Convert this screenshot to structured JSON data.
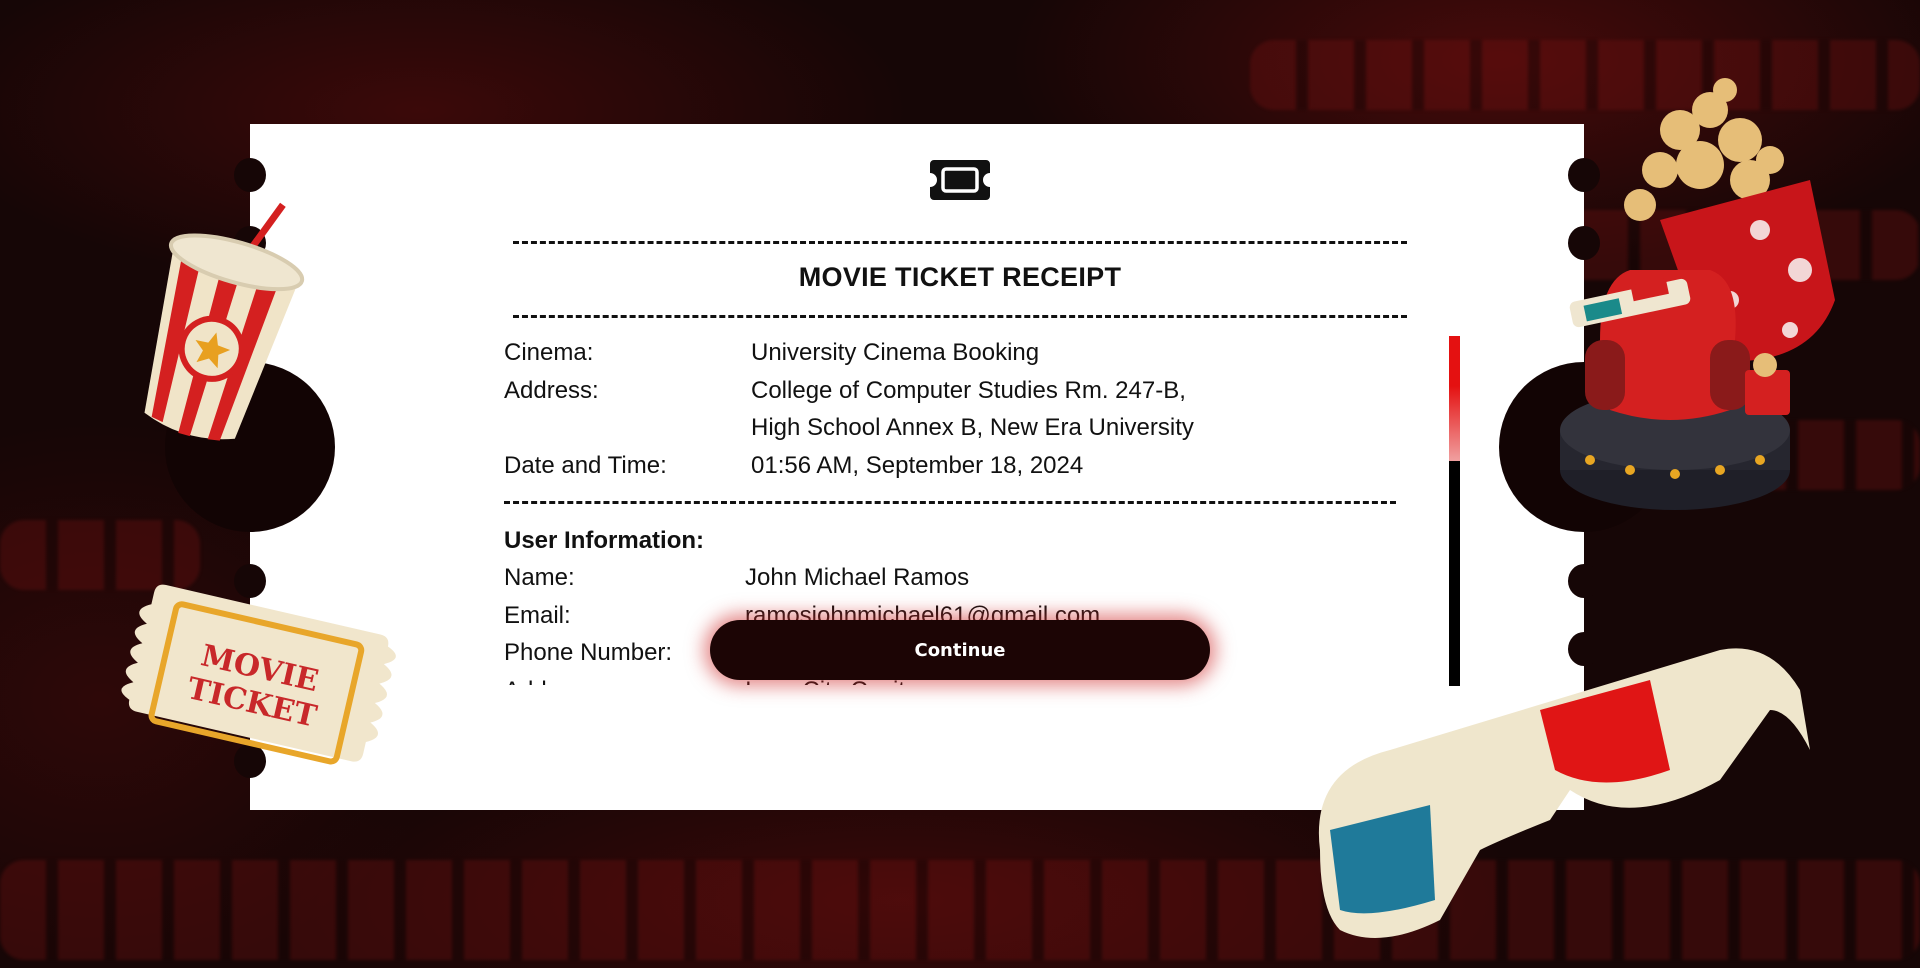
{
  "background_theme": "dark red cinema seats",
  "colors": {
    "accent": "#e41111",
    "button_bg": "#1c0505",
    "card_bg": "#ffffff"
  },
  "receipt": {
    "title": "MOVIE TICKET RECEIPT",
    "header_icon": "ticket-icon",
    "cinema_label": "Cinema:",
    "cinema_value": "University Cinema Booking",
    "address_label": "Address:",
    "address_line1": "College of Computer Studies Rm. 247-B,",
    "address_line2": "High School Annex B, New Era University",
    "datetime_label": "Date and Time:",
    "datetime_value": "01:56 AM, September 18, 2024",
    "user_section_title": "User Information:",
    "name_label": "Name:",
    "name_value": "John Michael Ramos",
    "email_label": "Email:",
    "email_value": "ramosjohnmichael61@gmail.com",
    "phone_label": "Phone Number:",
    "phone_value": "",
    "address2_label": "Address:",
    "address2_value": "Iwan City Cavite"
  },
  "scroll": {
    "position_fraction": 0.0
  },
  "continue_button": {
    "label": "Continue"
  },
  "decorations": {
    "soda_cup": "soda-cup-icon",
    "movie_ticket": {
      "icon": "movie-ticket-icon",
      "text_line1": "MOVIE",
      "text_line2": "TICKET"
    },
    "popcorn_chair": "popcorn-chair-icon",
    "glasses": "3d-glasses-icon"
  }
}
